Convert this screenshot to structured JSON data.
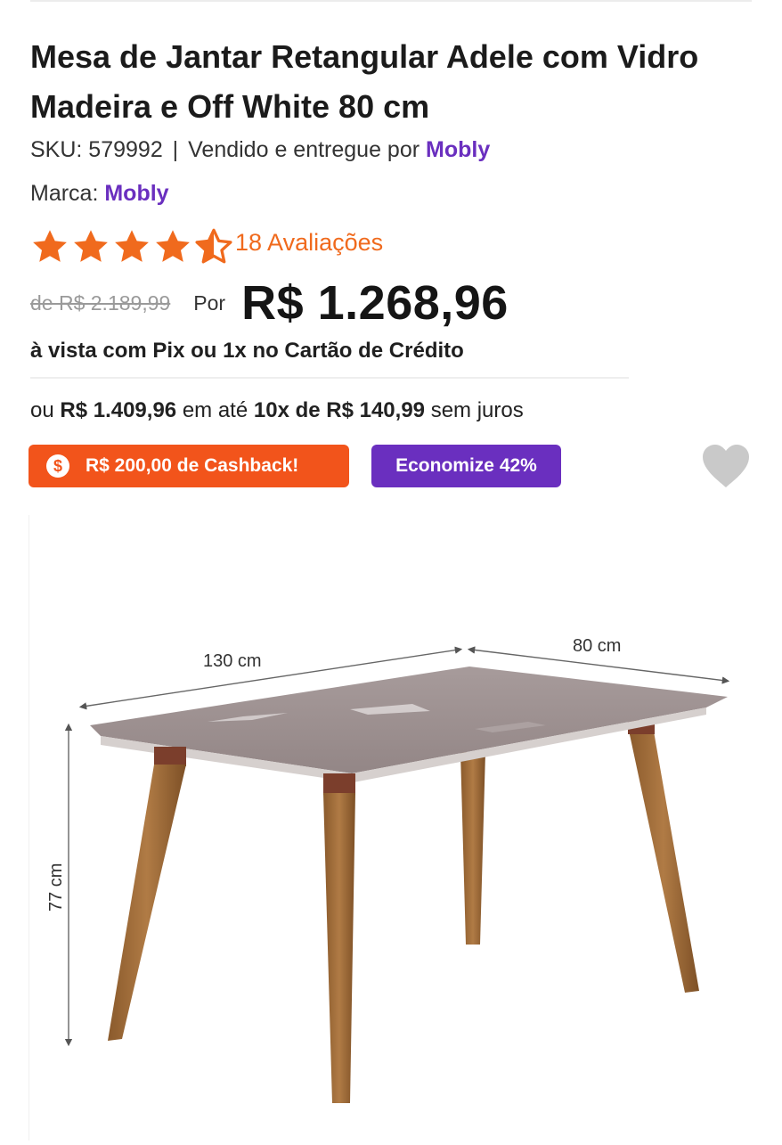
{
  "product": {
    "title": "Mesa de Jantar Retangular Adele com Vidro Madeira e Off White 80 cm",
    "sku_label": "SKU: 579992",
    "separator": "|",
    "sold_by_text": "Vendido e entregue por",
    "seller": "Mobly",
    "brand_label": "Marca:",
    "brand": "Mobly"
  },
  "rating": {
    "value": 4.5,
    "max": 5,
    "reviews_text": "18 Avaliações"
  },
  "pricing": {
    "old_price": "de R$ 2.189,99",
    "por_label": "Por",
    "price": "R$ 1.268,96",
    "pix_text": "à vista com Pix ou 1x no Cartão de Crédito",
    "installment_prefix": "ou",
    "installment_total": "R$ 1.409,96",
    "installment_middle": "em até",
    "installment_plan": "10x de R$ 140,99",
    "installment_suffix": "sem juros"
  },
  "badges": {
    "cashback_icon_glyph": "$",
    "cashback": "R$ 200,00 de Cashback!",
    "discount": "Economize 42%"
  },
  "image": {
    "dim_width": "130 cm",
    "dim_depth": "80 cm",
    "dim_height": "77 cm"
  },
  "colors": {
    "accent_purple": "#6a2fbf",
    "accent_orange": "#f2541b",
    "star_orange": "#f06a1d"
  },
  "icons": {
    "favorite": "heart-icon",
    "cashback": "dollar-coin-icon",
    "rating": "star-icon"
  }
}
